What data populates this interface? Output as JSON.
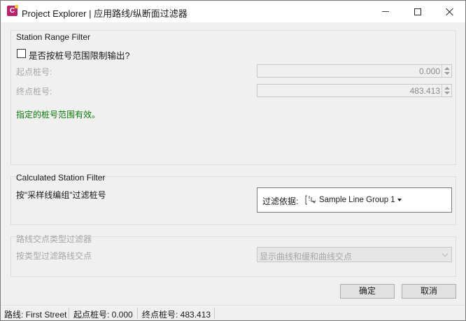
{
  "window": {
    "title": "Project Explorer | 应用路线/纵断面过滤器",
    "icon": "civil3d-app-icon",
    "app_icon_letter": "C"
  },
  "station_range": {
    "group_title": "Station Range Filter",
    "checkbox_label": "是否按桩号范围限制输出?",
    "checkbox_checked": false,
    "start_label": "起点桩号:",
    "start_value": "0.000",
    "end_label": "终点桩号:",
    "end_value": "483.413",
    "valid_message": "指定的桩号范围有效。",
    "valid_color": "#0a7a0a"
  },
  "calculated_filter": {
    "group_title": "Calculated Station Filter",
    "description": "按\"采样线编组\"过滤桩号",
    "filter_label": "过滤依据:",
    "filter_value": "Sample Line Group 1"
  },
  "pi_filter": {
    "group_title": "路线交点类型过滤器",
    "description": "按类型过滤路线交点",
    "selected_option": "显示曲线和缓和曲线交点"
  },
  "buttons": {
    "ok": "确定",
    "cancel": "取消"
  },
  "status": {
    "route": "路线: First Street",
    "start": "起点桩号: 0.000",
    "end": "终点桩号: 483.413"
  }
}
